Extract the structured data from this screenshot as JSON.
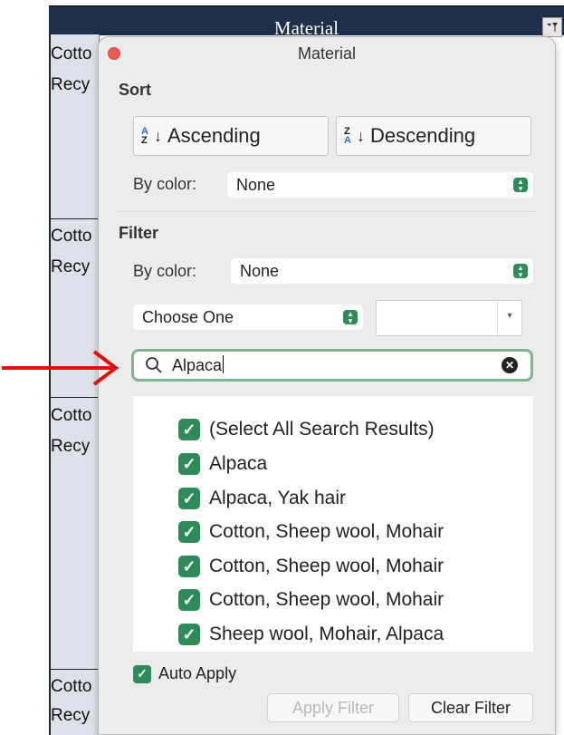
{
  "sheet": {
    "column_header": "Material",
    "cells": [
      "Cotto",
      "Recy",
      "Cotto",
      "Recy",
      "Cotto",
      "Recy",
      "Cotto",
      "Recy"
    ]
  },
  "popover": {
    "title": "Material",
    "sort": {
      "section_label": "Sort",
      "ascending_label": "Ascending",
      "descending_label": "Descending",
      "by_color_label": "By color:",
      "by_color_value": "None"
    },
    "filter": {
      "section_label": "Filter",
      "by_color_label": "By color:",
      "by_color_value": "None",
      "condition_value": "Choose One",
      "condition_text": ""
    },
    "search": {
      "value": "Alpaca"
    },
    "results": [
      {
        "label": "(Select All Search Results)",
        "checked": true
      },
      {
        "label": "Alpaca",
        "checked": true
      },
      {
        "label": "Alpaca, Yak hair",
        "checked": true
      },
      {
        "label": "Cotton, Sheep wool, Mohair",
        "checked": true
      },
      {
        "label": "Cotton, Sheep wool, Mohair",
        "checked": true
      },
      {
        "label": "Cotton, Sheep wool, Mohair",
        "checked": true
      },
      {
        "label": "Sheep wool, Mohair, Alpaca",
        "checked": true
      }
    ],
    "auto_apply_label": "Auto Apply",
    "auto_apply_checked": true,
    "apply_filter_label": "Apply Filter",
    "clear_filter_label": "Clear Filter"
  },
  "colors": {
    "header_bg": "#1f2f4a",
    "accent_green": "#2e8b57",
    "annotation_arrow": "#e3100f",
    "close_button": "#ee5b52"
  }
}
